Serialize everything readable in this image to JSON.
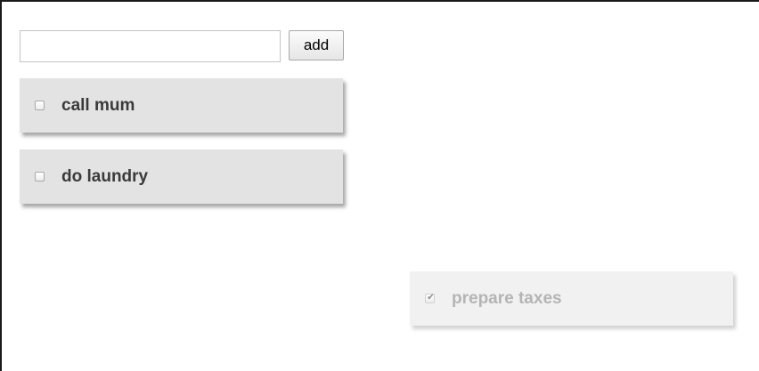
{
  "form": {
    "input_value": "",
    "add_label": "add"
  },
  "todos": [
    {
      "text": "call mum",
      "done": false
    },
    {
      "text": "do laundry",
      "done": false
    },
    {
      "text": "prepare taxes",
      "done": true,
      "check_glyph": "✔"
    }
  ],
  "colors": {
    "card_background": "#e3e3e3",
    "done_card_background": "#f1f1f1",
    "text": "#3a3a3a",
    "done_text": "#b4b4b4"
  }
}
